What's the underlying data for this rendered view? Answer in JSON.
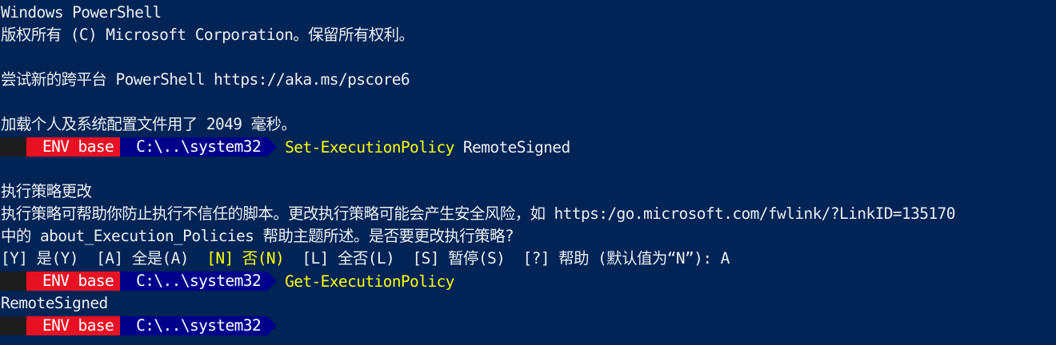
{
  "terminal": {
    "header": [
      "Windows PowerShell",
      "版权所有 (C) Microsoft Corporation。保留所有权利。",
      "尝试新的跨平台 PowerShell https://aka.ms/pscore6",
      "加载个人及系统配置文件用了 2049 毫秒。"
    ],
    "prompt": {
      "env_label": "ENV base",
      "path_label": "C:\\..\\system32"
    },
    "cmd1": {
      "command": "Set-ExecutionPolicy",
      "argument": " RemoteSigned"
    },
    "policy": {
      "title": "执行策略更改",
      "desc1": "执行策略可帮助你防止执行不信任的脚本。更改执行策略可能会产生安全风险，如 https:/go.microsoft.com/fwlink/?LinkID=135170",
      "desc2": "中的 about_Execution_Policies 帮助主题所述。是否要更改执行策略?",
      "choice_y": "[Y] 是(Y)  [A] 全是(A)  ",
      "choice_n": "[N] 否(N)",
      "choice_rest": "  [L] 全否(L)  [S] 暂停(S)  [?] 帮助 (默认值为“N”): A"
    },
    "cmd2": {
      "command": "Get-ExecutionPolicy"
    },
    "output": "RemoteSigned"
  },
  "colors": {
    "background": "#012456",
    "text": "#EEEDF0",
    "bolt_segment": "#1d1d1d",
    "env_segment": "#e81123",
    "path_segment": "#00008b",
    "command": "#FFFF00"
  },
  "icons": {
    "bolt": "lightning-bolt-icon"
  }
}
